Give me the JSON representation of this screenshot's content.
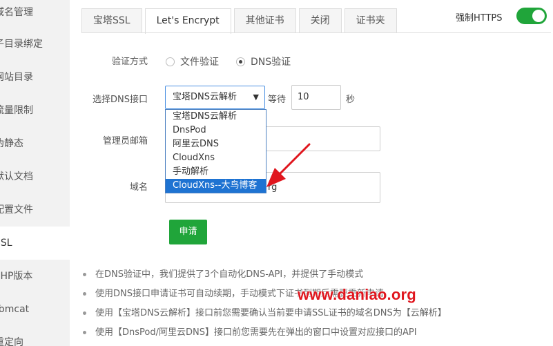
{
  "sidebar": {
    "items": [
      {
        "label": "域名管理"
      },
      {
        "label": "子目录绑定"
      },
      {
        "label": "网站目录"
      },
      {
        "label": "流量限制"
      },
      {
        "label": "伪静态"
      },
      {
        "label": "默认文档"
      },
      {
        "label": "配置文件"
      },
      {
        "label": "SSL"
      },
      {
        "label": "PHP版本"
      },
      {
        "label": "Tomcat"
      },
      {
        "label": "重定向"
      }
    ],
    "active_index": 7
  },
  "tabs": [
    {
      "label": "宝塔SSL"
    },
    {
      "label": "Let's Encrypt"
    },
    {
      "label": "其他证书"
    },
    {
      "label": "关闭"
    },
    {
      "label": "证书夹"
    }
  ],
  "force_https": {
    "label": "强制HTTPS",
    "enabled": true
  },
  "form": {
    "verify_label": "验证方式",
    "verify_options": [
      {
        "label": "文件验证",
        "checked": false
      },
      {
        "label": "DNS验证",
        "checked": true
      }
    ],
    "dns_label": "选择DNS接口",
    "dns_selected": "宝塔DNS云解析",
    "wait_label": "等待",
    "wait_value": "10",
    "wait_unit": "秒",
    "email_label": "管理员邮箱",
    "domain_label": "域名",
    "domain_value_visible": "rg",
    "dns_options": [
      "宝塔DNS云解析",
      "DnsPod",
      "阿里云DNS",
      "CloudXns",
      "手动解析",
      "CloudXns--大鸟博客"
    ],
    "dns_highlighted_index": 5,
    "apply_label": "申请"
  },
  "tips": [
    "在DNS验证中，我们提供了3个自动化DNS-API，并提供了手动模式",
    "使用DNS接口申请证书可自动续期，手动模式下证书到期后需要重新申请",
    "使用【宝塔DNS云解析】接口前您需要确认当前要申请SSL证书的域名DNS为【云解析】",
    "使用【DnsPod/阿里云DNS】接口前您需要先在弹出的窗口中设置对应接口的API"
  ],
  "watermark": "www.daniao.org",
  "colors": {
    "accent_green": "#20a53a",
    "select_blue": "#1e73d2",
    "watermark_red": "#e0161e"
  }
}
